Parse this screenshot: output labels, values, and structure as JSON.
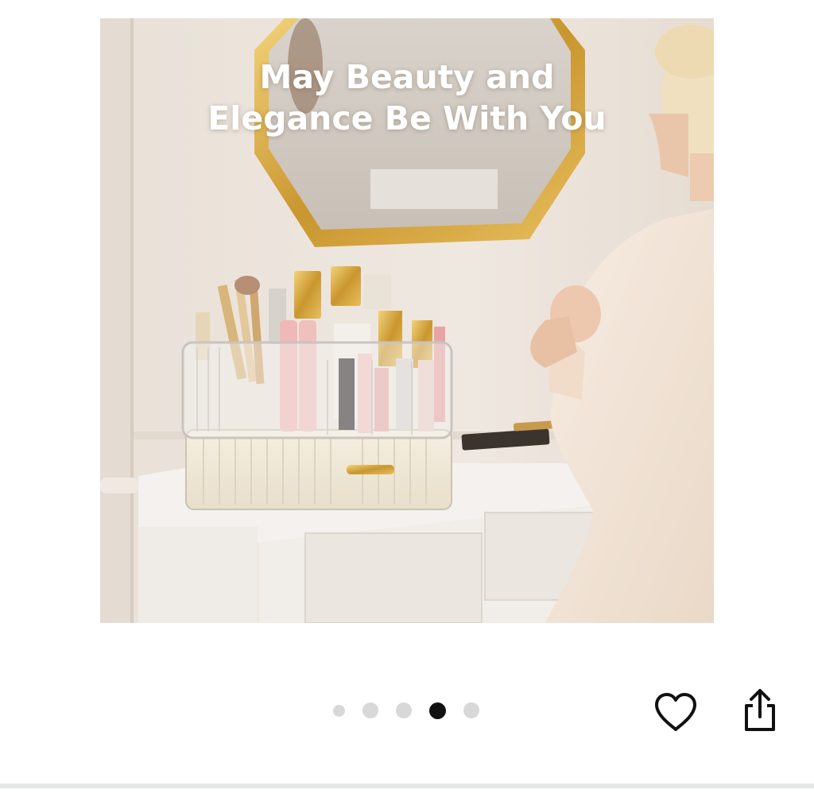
{
  "product_image": {
    "headline_line1": "May Beauty and",
    "headline_line2": "Elegance Be With You"
  },
  "carousel": {
    "total_slides": 5,
    "active_index": 3
  },
  "actions": {
    "favorite_icon": "heart-outline-icon",
    "share_icon": "share-icon"
  },
  "colors": {
    "active_dot": "#111111",
    "inactive_dot": "#d8d8d8"
  }
}
